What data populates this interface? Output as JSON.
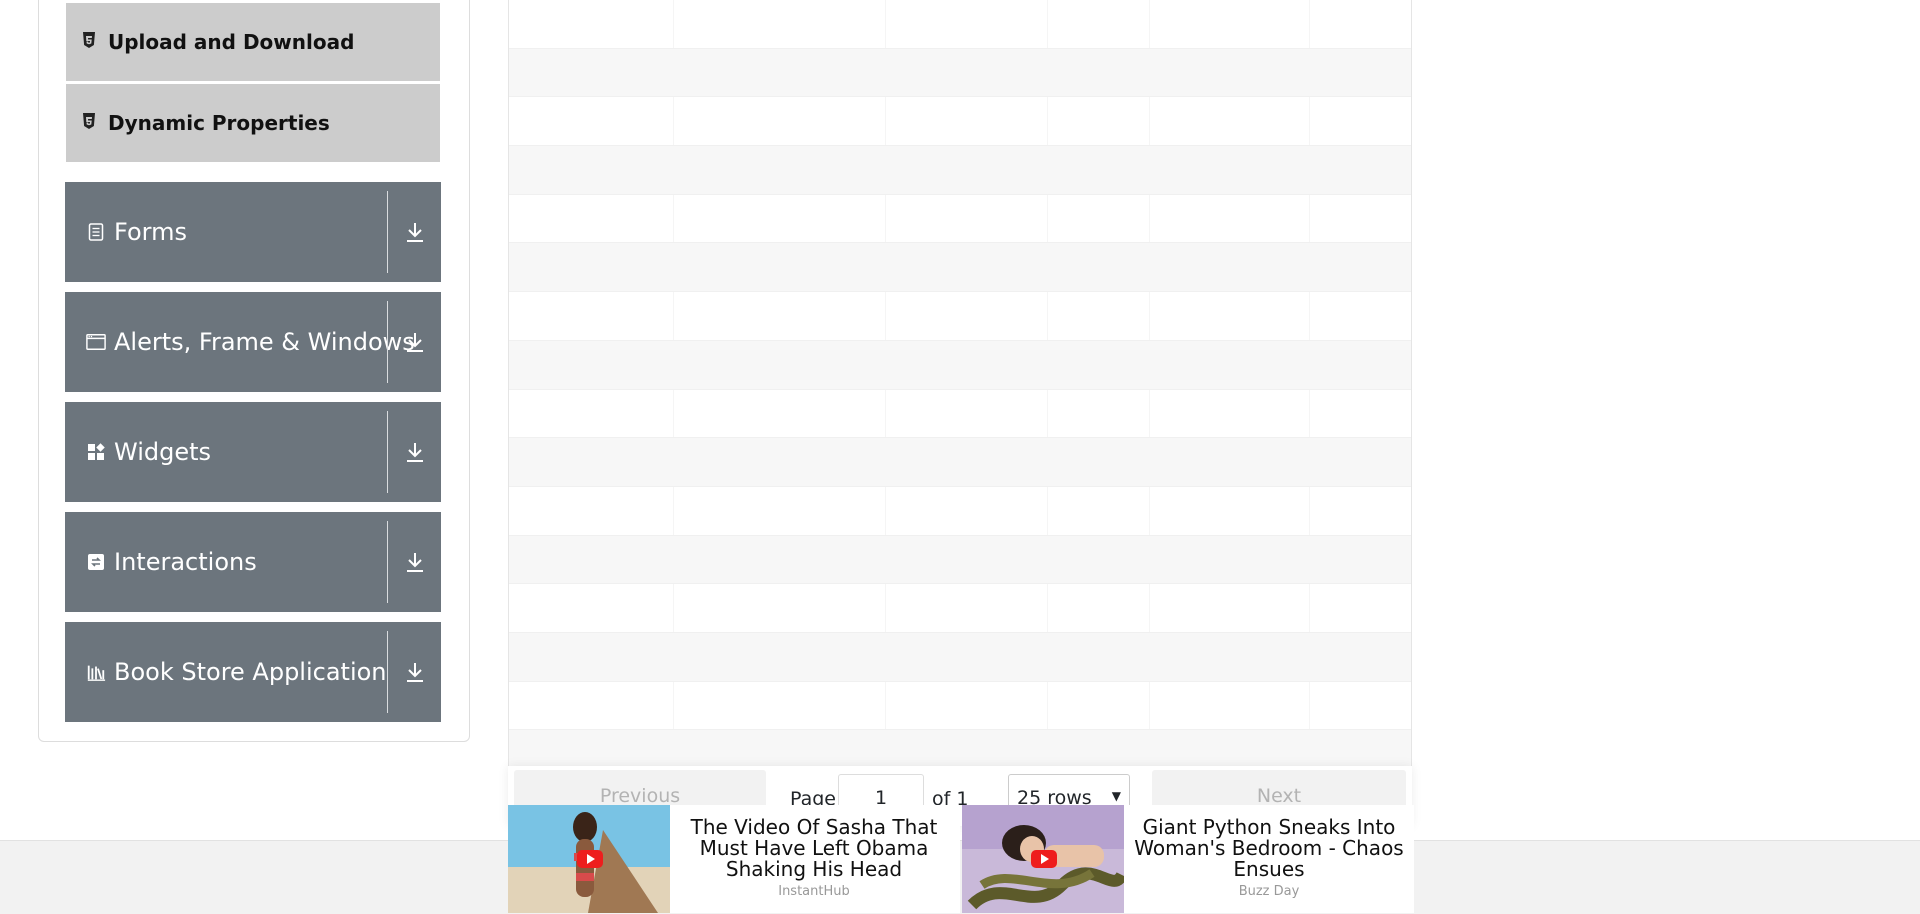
{
  "sidebar": {
    "sub_items": [
      {
        "label": "Upload and Download",
        "icon": "html5-icon"
      },
      {
        "label": "Dynamic Properties",
        "icon": "html5-icon"
      }
    ],
    "groups": [
      {
        "label": "Forms",
        "icon": "document-icon"
      },
      {
        "label": "Alerts, Frame & Windows",
        "icon": "window-icon"
      },
      {
        "label": "Widgets",
        "icon": "widgets-icon"
      },
      {
        "label": "Interactions",
        "icon": "interactions-icon"
      },
      {
        "label": "Book Store Application",
        "icon": "bookshelf-icon"
      }
    ]
  },
  "pagination": {
    "previous_label": "Previous",
    "page_label": "Page",
    "page_value": "1",
    "of_label": "of 1",
    "rows_select": "25 rows",
    "next_label": "Next"
  },
  "ads": [
    {
      "title": "The Video Of Sasha That Must Have Left Obama Shaking His Head",
      "source": "InstantHub"
    },
    {
      "title": "Giant Python Sneaks Into Woman's Bedroom - Chaos Ensues",
      "source": "Buzz Day"
    }
  ],
  "colors": {
    "sidebar_group_bg": "#6c757d",
    "sidebar_sub_bg": "#cccccc",
    "row_stripe": "#f7f7f7",
    "footer_bg": "#f2f2f2",
    "youtube_red": "#ee1d1d"
  }
}
